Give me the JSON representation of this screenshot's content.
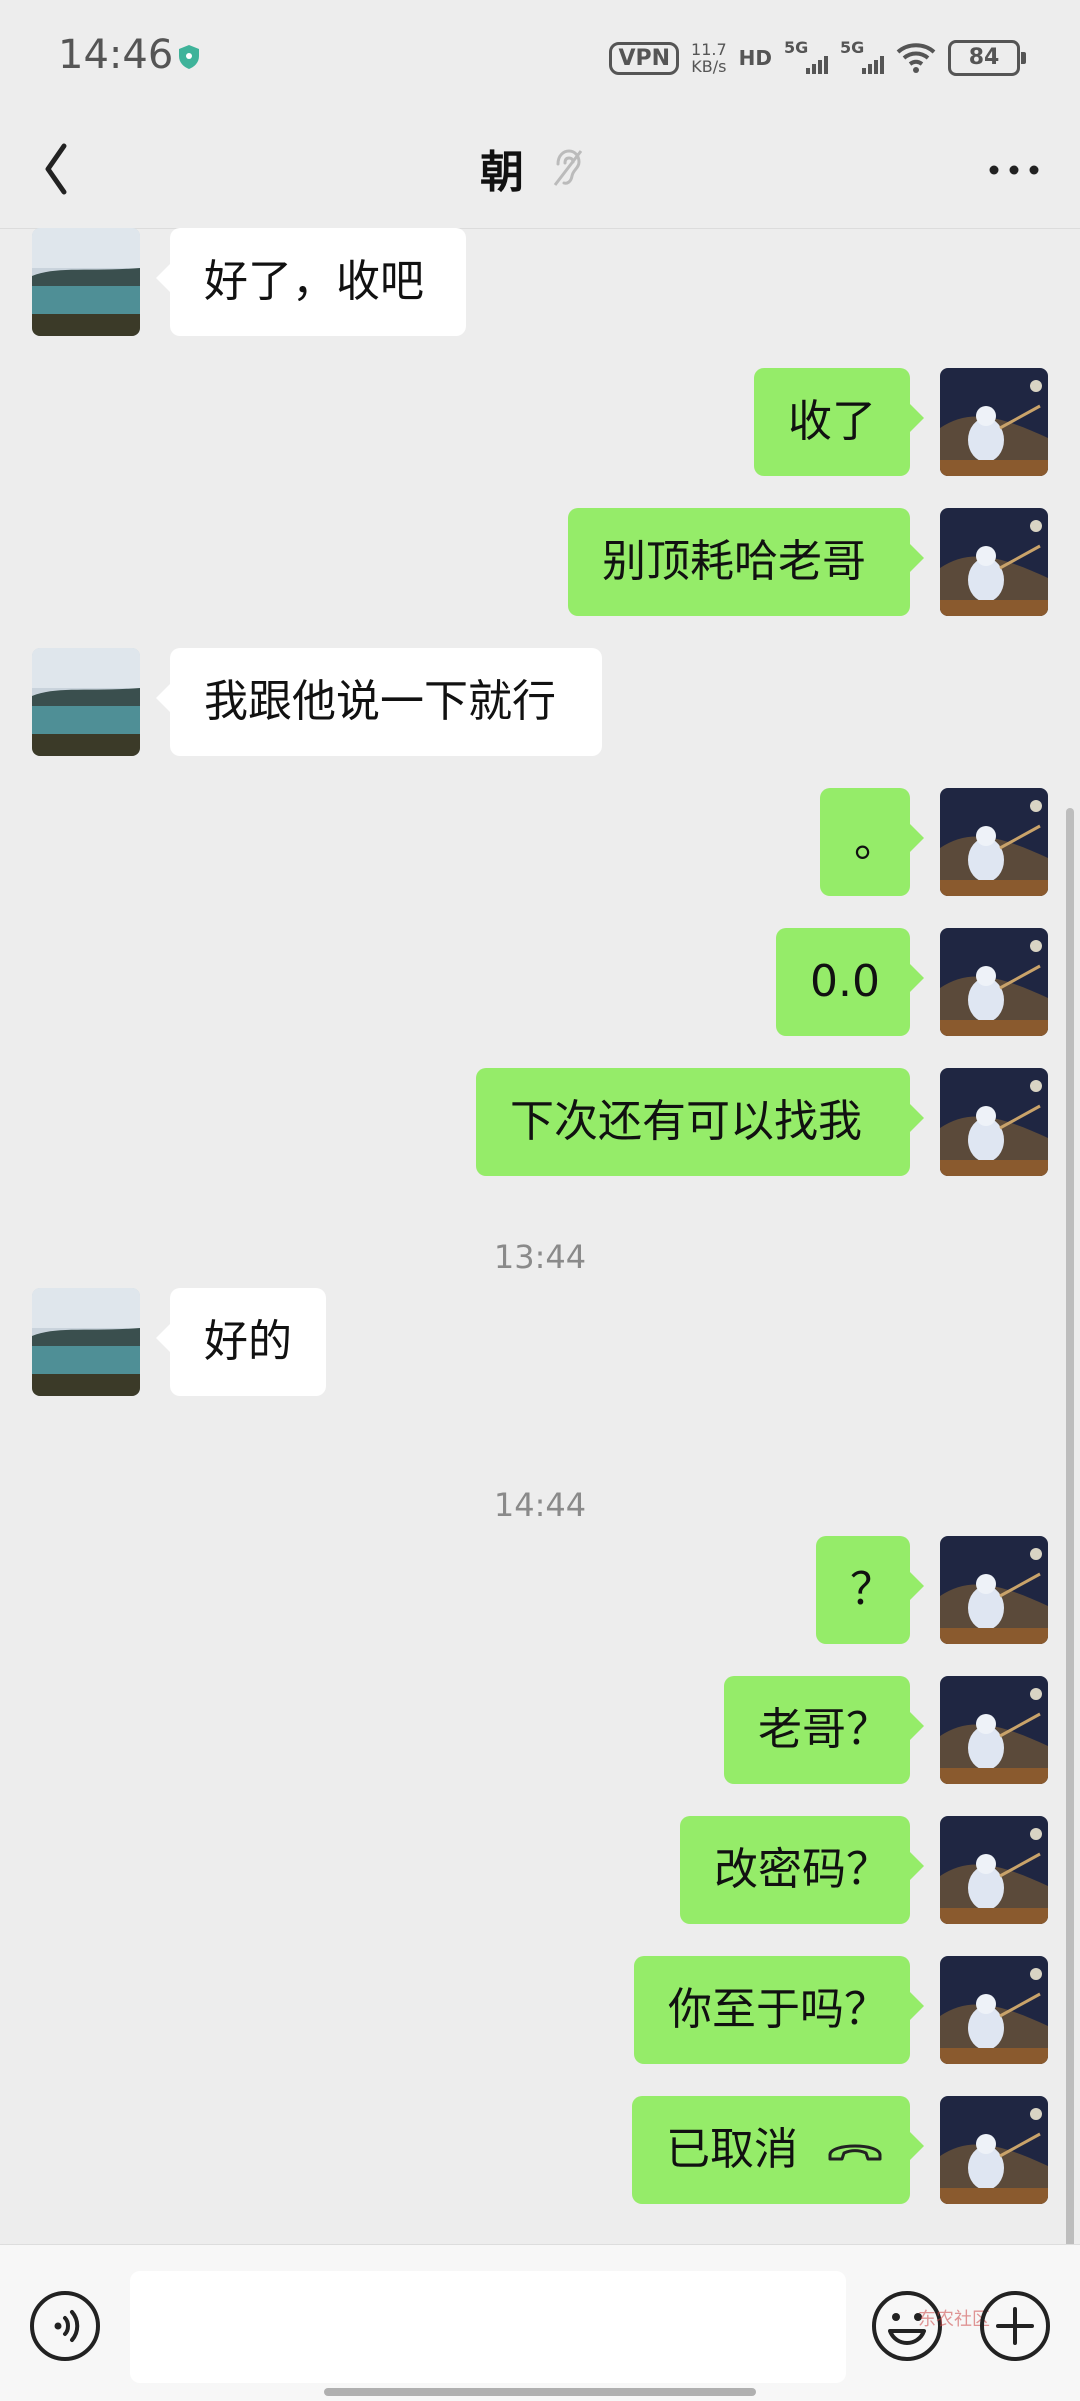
{
  "status_bar": {
    "time": "14:46",
    "vpn": "VPN",
    "speed_value": "11.7",
    "speed_unit": "KB/s",
    "hd": "HD",
    "signal1": "5G",
    "signal2": "5G",
    "battery": "84"
  },
  "header": {
    "title": "朝",
    "icons": [
      "back-icon",
      "ear-icon",
      "more-icon"
    ]
  },
  "messages": [
    {
      "side": "left",
      "text": "好了，收吧"
    },
    {
      "side": "right",
      "text": "收了"
    },
    {
      "side": "right",
      "text": "别顶耗哈老哥"
    },
    {
      "side": "left",
      "text": "我跟他说一下就行"
    },
    {
      "side": "right",
      "text": "。"
    },
    {
      "side": "right",
      "text": "0.0"
    },
    {
      "side": "right",
      "text": "下次还有可以找我"
    },
    {
      "timestamp": "13:44"
    },
    {
      "side": "left",
      "text": "好的"
    },
    {
      "timestamp": "14:44"
    },
    {
      "side": "right",
      "text": "？"
    },
    {
      "side": "right",
      "text": "老哥？"
    },
    {
      "side": "right",
      "text": "改密码？"
    },
    {
      "side": "right",
      "text": "你至于吗？"
    },
    {
      "side": "right",
      "text": "已取消",
      "icon": "hangup-icon"
    }
  ],
  "input_bar": {
    "watermark": "东农社区",
    "icons": [
      "voice-icon",
      "emoji-icon",
      "plus-icon"
    ]
  },
  "colors": {
    "background": "#ededed",
    "self_bubble": "#95ec69",
    "other_bubble": "#ffffff"
  }
}
